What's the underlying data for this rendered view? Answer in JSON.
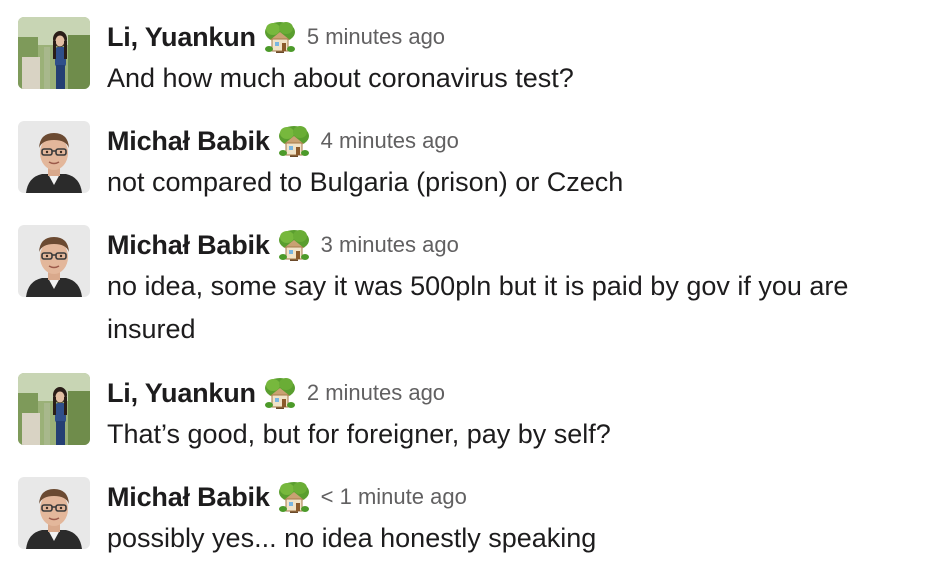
{
  "messages": [
    {
      "sender": "Li, Yuankun",
      "status_icon": "house-with-garden-icon",
      "timestamp": "5 minutes ago",
      "text": "And how much about coronavirus test?"
    },
    {
      "sender": "Michał Babik",
      "status_icon": "house-with-garden-icon",
      "timestamp": "4 minutes ago",
      "text": "not compared to Bulgaria (prison) or Czech"
    },
    {
      "sender": "Michał Babik",
      "status_icon": "house-with-garden-icon",
      "timestamp": "3 minutes ago",
      "text": "no idea, some say it was 500pln but it is paid by gov if you are insured"
    },
    {
      "sender": "Li, Yuankun",
      "status_icon": "house-with-garden-icon",
      "timestamp": "2 minutes ago",
      "text": "That’s good, but for foreigner, pay by self?"
    },
    {
      "sender": "Michał Babik",
      "status_icon": "house-with-garden-icon",
      "timestamp": "< 1 minute ago",
      "text": "possibly yes... no idea honestly speaking"
    }
  ],
  "colors": {
    "text": "#1d1c1d",
    "timestamp": "#616061",
    "background": "#ffffff"
  }
}
